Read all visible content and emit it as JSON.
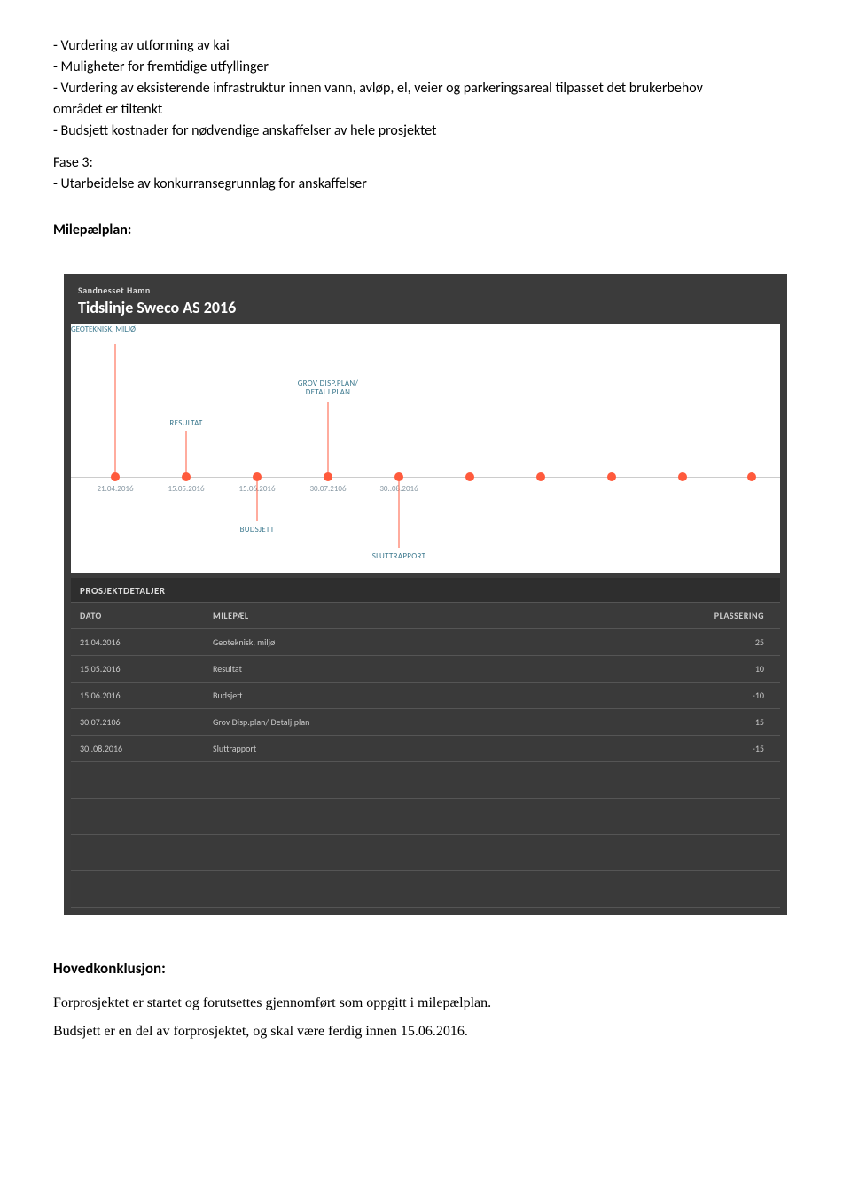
{
  "bullets": [
    "- Vurdering av utforming av kai",
    "- Muligheter for fremtidige utfyllinger",
    "- Vurdering av eksisterende infrastruktur innen vann, avløp, el, veier og parkeringsareal tilpasset det brukerbehov området er tiltenkt",
    "- Budsjett kostnader for nødvendige anskaffelser av hele prosjektet"
  ],
  "fase": {
    "title": "Fase 3:",
    "line": "- Utarbeidelse av konkurransegrunnlag for anskaffelser"
  },
  "milepael_heading": "Milepælplan:",
  "gantt": {
    "sub": "Sandnesset Hamn",
    "title": "Tidslinje Sweco AS 2016",
    "tl_label": "GEOTEKNISK, MILJØ",
    "anns": {
      "grov": "GROV DISP.PLAN/\nDETALJ.PLAN",
      "resultat": "RESULTAT",
      "budsjett": "BUDSJETT",
      "slutt": "SLUTTRAPPORT"
    },
    "ticks": [
      "21.04.2016",
      "15.05.2016",
      "15.06.2016",
      "30.07.2106",
      "30..08.2016"
    ],
    "details_head": "PROSJEKTDETALJER",
    "cols": [
      "DATO",
      "MILEPÆL",
      "PLASSERING"
    ],
    "rows": [
      {
        "dato": "21.04.2016",
        "milepael": "Geoteknisk, miljø",
        "plass": "25"
      },
      {
        "dato": "15.05.2016",
        "milepael": "Resultat",
        "plass": "10"
      },
      {
        "dato": "15.06.2016",
        "milepael": "Budsjett",
        "plass": "-10"
      },
      {
        "dato": "30.07.2106",
        "milepael": "Grov Disp.plan/ Detalj.plan",
        "plass": "15"
      },
      {
        "dato": "30..08.2016",
        "milepael": "Sluttrapport",
        "plass": "-15"
      }
    ]
  },
  "conclusion": {
    "head": "Hovedkonklusjon:",
    "p1": "Forprosjektet er startet og forutsettes gjennomført som oppgitt i milepælplan.",
    "p2": "Budsjett er en del av forprosjektet, og skal være ferdig innen 15.06.2016."
  },
  "chart_data": {
    "type": "table",
    "title": "Tidslinje Sweco AS 2016",
    "columns": [
      "DATO",
      "MILEPÆL",
      "PLASSERING"
    ],
    "rows": [
      [
        "21.04.2016",
        "Geoteknisk, miljø",
        25
      ],
      [
        "15.05.2016",
        "Resultat",
        10
      ],
      [
        "15.06.2016",
        "Budsjett",
        -10
      ],
      [
        "30.07.2106",
        "Grov Disp.plan/ Detalj.plan",
        15
      ],
      [
        "30..08.2016",
        "Sluttrapport",
        -15
      ]
    ]
  }
}
